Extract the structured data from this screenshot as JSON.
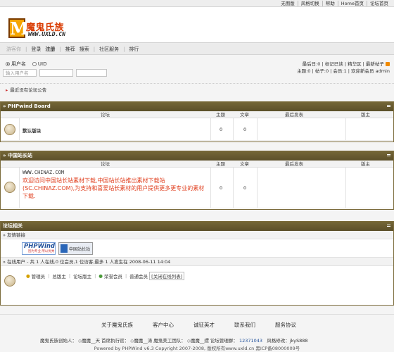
{
  "topbar": [
    "无图版",
    "风格切换",
    "帮助",
    "Home首页",
    "论坛首页"
  ],
  "logo": {
    "letter": "M",
    "name": "魔鬼氏族",
    "url": "WWW.UXLD.CN"
  },
  "nav": {
    "guest_label": "游客你",
    "items": [
      "登录",
      "注册",
      "推荐",
      "搜索",
      "社区服务",
      "排行"
    ]
  },
  "login": {
    "radio_username": "用户名",
    "radio_uid": "UID",
    "username_placeholder": "输入用户名",
    "stats_line1": [
      "最后日:0",
      "标记已读",
      "精华区",
      "最新帖子"
    ],
    "stats_line2": "主题:0 | 帖子:0 | 会员:1 | 欢迎新会员 admin"
  },
  "notice": "最近没有论坛公告",
  "board1": {
    "title": "» PHPwind Board",
    "headers": {
      "forum": "论坛",
      "topics": "主题",
      "posts": "文章",
      "last": "最后发表",
      "mod": "版主"
    },
    "rows": [
      {
        "name": "默认版块",
        "topics": "0",
        "posts": "0"
      }
    ]
  },
  "board2": {
    "title": "» 中国站长站",
    "headers": {
      "forum": "论坛",
      "topics": "主题",
      "posts": "文章",
      "last": "最后发表",
      "mod": "版主"
    },
    "rows": [
      {
        "name": "WWW.CHINAZ.COM",
        "desc": "欢迎访问中国站长站素材下载,中国站长站推出素材下载站(SC.CHINAZ.COM),为支持和喜爱站长素材的用户提供更多更专业的素材下载.",
        "topics": "0",
        "posts": "0"
      }
    ]
  },
  "related": {
    "title": "论坛相关",
    "friend_links": "» 友情链接",
    "phpwind_badge": "PHPWind",
    "phpwind_sub": "因为专业 所以优秀",
    "chinaz_badge": "中国站长站",
    "online_title": "» 在线用户 - 共 1 人在线,0 位会员,1 位访客,最多 1 人发生在 2008-06-11 14:04",
    "legend": [
      "管理员",
      "总版主",
      "论坛版主",
      "荣誉会员",
      "普通会员",
      "[关闭在线列表]"
    ]
  },
  "footer": {
    "links": [
      "关于魔鬼氏族",
      "客户中心",
      "诚征英才",
      "联系我们",
      "服务协议"
    ],
    "staff_line": "魔鬼氏族创始人：   ◇魔魔__天   首席执行官：   ◇魔魔__涛   魔鬼美工团队：   ◇魔魔__缥   论坛管理群：",
    "qq": "12371043",
    "style_label": "风格修改：jkyS888",
    "copyright": "Powered by PHPWind v6.3 Copyright 2007-2008, 版权所有www.uxld.cn 黑ICP备08000009号"
  },
  "colors": {
    "panel_header": "#6b5d31",
    "accent_red": "#d93a00",
    "link_blue": "#1f4f9a"
  }
}
